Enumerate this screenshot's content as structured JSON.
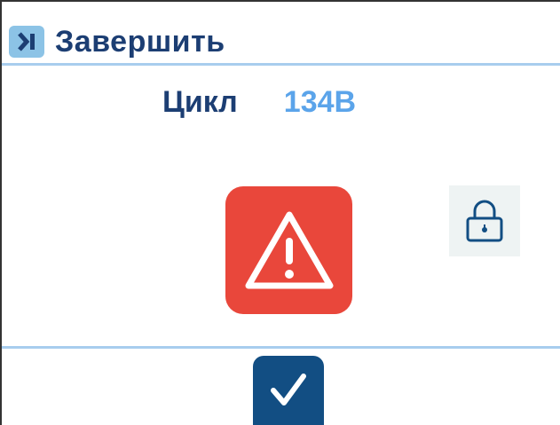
{
  "header": {
    "title": "Завершить",
    "back_icon": "exit-arrow-icon"
  },
  "cycle": {
    "label": "Цикл",
    "value": "134B"
  },
  "buttons": {
    "warning_icon": "warning-triangle-icon",
    "lock_icon": "padlock-icon",
    "confirm_icon": "checkmark-icon"
  },
  "colors": {
    "title": "#1c3e73",
    "accent": "#5ba4ea",
    "warning": "#e9473b",
    "confirm": "#124e83",
    "divider": "#a8cdee"
  }
}
